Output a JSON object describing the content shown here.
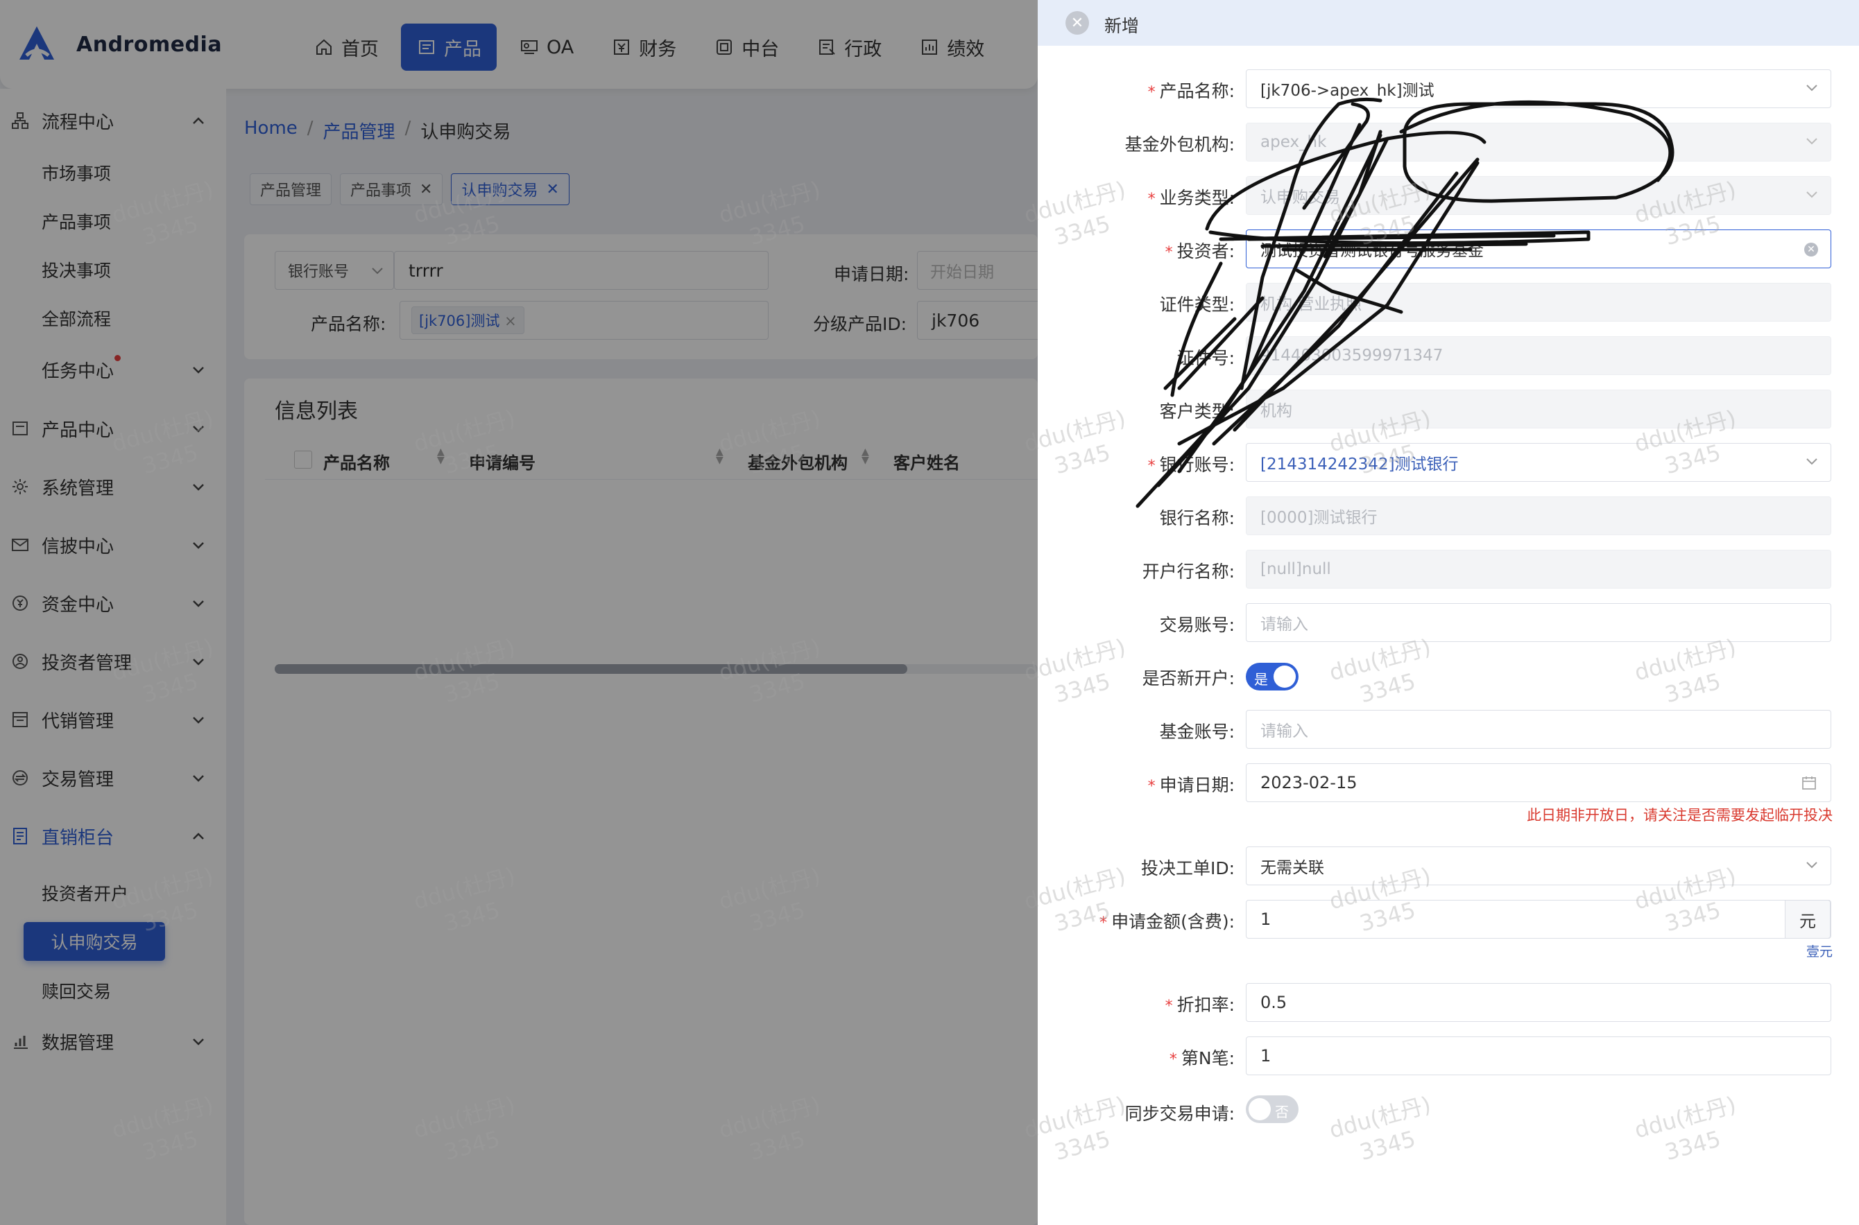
{
  "app": {
    "name": "Andromedia"
  },
  "nav": [
    {
      "label": "首页",
      "icon": "home-icon"
    },
    {
      "label": "产品",
      "icon": "product-icon"
    },
    {
      "label": "OA",
      "icon": "oa-icon"
    },
    {
      "label": "财务",
      "icon": "finance-icon"
    },
    {
      "label": "中台",
      "icon": "middle-platform-icon"
    },
    {
      "label": "行政",
      "icon": "admin-icon"
    },
    {
      "label": "绩效",
      "icon": "performance-icon"
    }
  ],
  "sidebar": {
    "groups": {
      "process": "流程中心",
      "product": "产品中心",
      "system": "系统管理",
      "disclosure": "信披中心",
      "fund": "资金中心",
      "investor": "投资者管理",
      "agency": "代销管理",
      "trade": "交易管理",
      "direct": "直销柜台",
      "data": "数据管理"
    },
    "process_items": [
      "市场事项",
      "产品事项",
      "投决事项",
      "全部流程",
      "任务中心"
    ],
    "direct_items": [
      "投资者开户",
      "认申购交易",
      "赎回交易"
    ]
  },
  "breadcrumb": [
    "Home",
    "/",
    "产品管理",
    "/",
    "认申购交易"
  ],
  "tabs": [
    "产品管理",
    "产品事项",
    "认申购交易"
  ],
  "filters": {
    "bank_select": "银行账号",
    "bank_value": "trrrr",
    "date_label": "申请日期:",
    "date_placeholder": "开始日期",
    "product_label": "产品名称:",
    "product_tag": "[jk706]测试",
    "class_label": "分级产品ID:",
    "class_value": "jk706"
  },
  "list": {
    "title": "信息列表",
    "columns": [
      "产品名称",
      "申请编号",
      "基金外包机构",
      "客户姓名"
    ]
  },
  "watermark": {
    "line1": "ddu(杜丹)",
    "line2": "3345"
  },
  "drawer": {
    "title": "新增",
    "fields": {
      "product_name": {
        "label": "产品名称:",
        "value": "[jk706->apex_hk]测试"
      },
      "outsource": {
        "label": "基金外包机构:",
        "value": "apex_hk"
      },
      "biz_type": {
        "label": "业务类型:",
        "value": "认申购交易"
      },
      "investor": {
        "label": "投资者:",
        "value": "测试投资者测试银行号服务基金"
      },
      "id_type": {
        "label": "证件类型:",
        "value": "机构-营业执照"
      },
      "id_no": {
        "label": "证件号:",
        "value": "91440300359997134​7"
      },
      "cust_type": {
        "label": "客户类型:",
        "value": "机构"
      },
      "bank_account": {
        "label": "银行账号:",
        "value": "[214314242342]测试银行"
      },
      "bank_name": {
        "label": "银行名称:",
        "value": "[0000]测试银行"
      },
      "branch": {
        "label": "开户行名称:",
        "value": "[null]null"
      },
      "trade_account": {
        "label": "交易账号:",
        "placeholder": "请输入"
      },
      "new_account": {
        "label": "是否新开户:",
        "on_text": "是"
      },
      "fund_account": {
        "label": "基金账号:",
        "placeholder": "请输入"
      },
      "apply_date": {
        "label": "申请日期:",
        "value": "2023-02-15",
        "error": "此日期非开放日，请关注是否需要发起临开投决"
      },
      "decision_id": {
        "label": "投决工单ID:",
        "value": "无需关联"
      },
      "amount": {
        "label": "申请金额(含费):",
        "value": "1",
        "unit": "元",
        "hint": "壹元"
      },
      "discount": {
        "label": "折扣率:",
        "value": "0.5"
      },
      "nth": {
        "label": "第N笔:",
        "value": "1"
      },
      "sync": {
        "label": "同步交易申请:",
        "off_text": "否"
      }
    }
  }
}
